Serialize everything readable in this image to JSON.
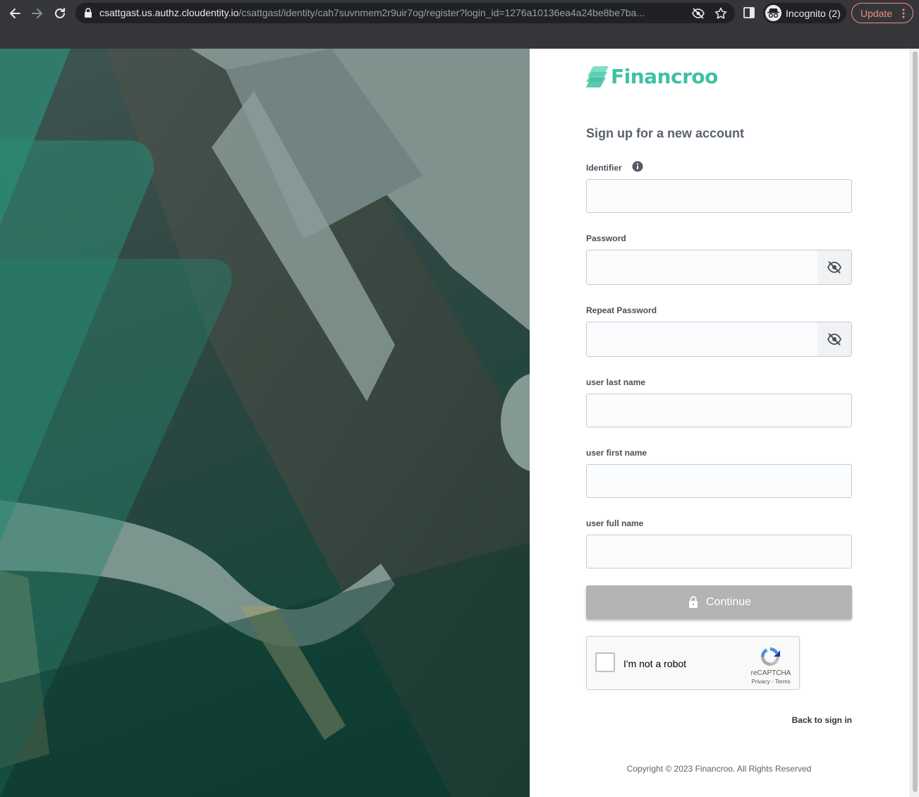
{
  "browser": {
    "url_host": "csattgast.us.authz.cloudentity.io",
    "url_path": "/csattgast/identity/cah7suvnmem2r9uir7og/register?login_id=1276a10136ea4a24be8be7ba...",
    "incognito_label": "Incognito (2)",
    "update_label": "Update",
    "icons": [
      "back-icon",
      "forward-icon",
      "reload-icon",
      "lock-icon",
      "eye-off-icon",
      "star-icon",
      "side-panel-icon",
      "incognito-icon",
      "more-icon"
    ]
  },
  "brand": {
    "name": "Financroo",
    "accent": "#3fc1a3"
  },
  "form": {
    "heading": "Sign up for a new account",
    "fields": [
      {
        "label": "Identifier",
        "value": "",
        "placeholder": ""
      },
      {
        "label": "Password",
        "value": "",
        "placeholder": ""
      },
      {
        "label": "Repeat Password",
        "value": "",
        "placeholder": ""
      },
      {
        "label": "user last name",
        "value": "",
        "placeholder": ""
      },
      {
        "label": "user first name",
        "value": "",
        "placeholder": ""
      },
      {
        "label": "user full name",
        "value": "",
        "placeholder": ""
      }
    ],
    "continue_label": "Continue",
    "recaptcha": {
      "label": "I'm not a robot",
      "brand": "reCAPTCHA",
      "terms": "Privacy - Terms"
    },
    "back_link": "Back to sign in"
  },
  "footer": {
    "copyright": "Copyright © 2023 Financroo. All Rights Reserved"
  },
  "colors": {
    "chrome_bg": "#35363a",
    "omnibox_bg": "#202124",
    "update": "#f28b82",
    "button_disabled": "#b3b3b3"
  }
}
